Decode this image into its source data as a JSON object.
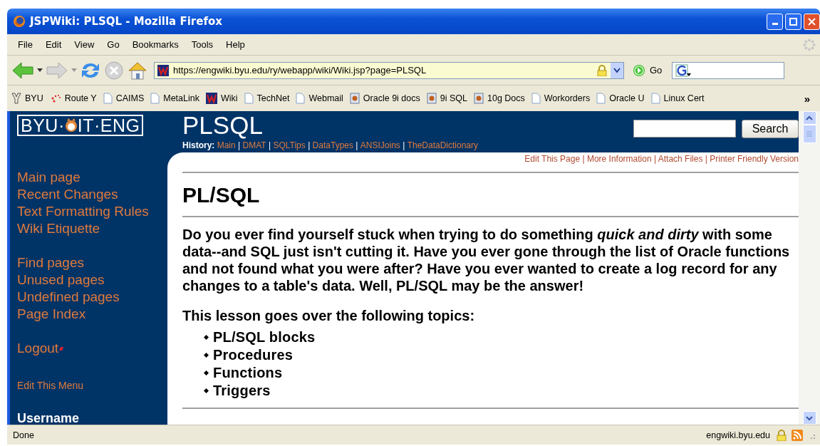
{
  "window": {
    "title": "JSPWiki: PLSQL - Mozilla Firefox"
  },
  "menu": [
    "File",
    "Edit",
    "View",
    "Go",
    "Bookmarks",
    "Tools",
    "Help"
  ],
  "navigation": {
    "address": "https://engwiki.byu.edu/ry/webapp/wiki/Wiki.jsp?page=PLSQL",
    "go_label": "Go"
  },
  "bookmarks": [
    {
      "label": "BYU",
      "kind": "byu"
    },
    {
      "label": "Route Y",
      "kind": "dots"
    },
    {
      "label": "CAIMS",
      "kind": "page"
    },
    {
      "label": "MetaLink",
      "kind": "page"
    },
    {
      "label": "Wiki",
      "kind": "wiki"
    },
    {
      "label": "TechNet",
      "kind": "page"
    },
    {
      "label": "Webmail",
      "kind": "page"
    },
    {
      "label": "Oracle 9i docs",
      "kind": "doc"
    },
    {
      "label": "9i SQL",
      "kind": "doc"
    },
    {
      "label": "10g Docs",
      "kind": "doc"
    },
    {
      "label": "Workorders",
      "kind": "page"
    },
    {
      "label": "Oracle U",
      "kind": "page"
    },
    {
      "label": "Linux Cert",
      "kind": "page"
    }
  ],
  "bookmarks_more": "»",
  "wiki": {
    "logo_left": "BYU·",
    "logo_right": "IT·ENG",
    "title": "PLSQL",
    "history_label": "History:",
    "separator": "|",
    "history": [
      "Main",
      "DMAT",
      "SQLTips",
      "DataTypes",
      "ANSIJoins",
      "TheDataDictionary"
    ],
    "search_button": "Search",
    "sidebar_groups": [
      [
        "Main page",
        "Recent Changes",
        "Text Formatting Rules",
        "Wiki Etiquette"
      ],
      [
        "Find pages",
        "Unused pages",
        "Undefined pages",
        "Page Index"
      ],
      [
        "Logout"
      ]
    ],
    "edit_menu": "Edit This Menu",
    "username_label": "Username",
    "page_actions": [
      "Edit This Page",
      "More Information",
      "Attach Files",
      "Printer Friendly Version"
    ],
    "heading": "PL/SQL",
    "intro": "Do you ever find yourself stuck when trying to do something *quick and dirty* with some data--and SQL just isn't cutting it. Have you ever gone through the list of Oracle functions and not found what you were after? Have you ever wanted to create a log record for any changes to a table's data. Well, PL/SQL may be the answer!",
    "topics_intro": "This lesson goes over the following topics:",
    "topics": [
      "PL/SQL blocks",
      "Procedures",
      "Functions",
      "Triggers"
    ]
  },
  "status_bar": {
    "text": "Done",
    "domain": "engwiki.byu.edu"
  }
}
